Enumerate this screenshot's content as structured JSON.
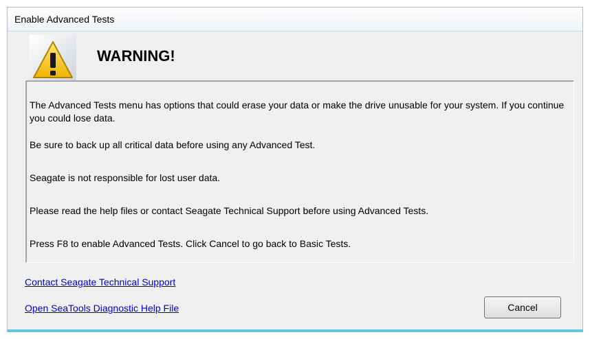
{
  "window": {
    "title": "Enable Advanced Tests"
  },
  "warning": {
    "heading": "WARNING!",
    "icon": "warning-icon"
  },
  "messages": [
    "The Advanced Tests menu has options that could erase your data or make the drive unusable for your system.  If you continue you could lose data.",
    "Be sure to back up all critical data before using any Advanced Test.",
    "Seagate is not responsible for lost user data.",
    "Please read the help files or contact Seagate Technical Support before using Advanced Tests.",
    "Press F8 to enable Advanced Tests. Click Cancel to go back to Basic Tests."
  ],
  "links": {
    "support": "Contact Seagate Technical Support",
    "help": "Open SeaTools Diagnostic Help File"
  },
  "buttons": {
    "cancel": "Cancel"
  },
  "colors": {
    "link": "#0000cc",
    "warning_yellow": "#f5c400",
    "accent_border": "#66c8e0"
  }
}
